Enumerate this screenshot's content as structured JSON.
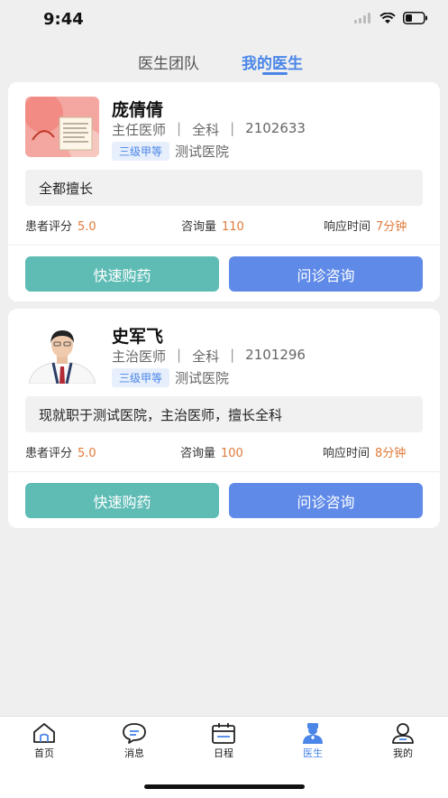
{
  "status": {
    "time": "9:44"
  },
  "tabs": [
    {
      "label": "医生团队",
      "active": false
    },
    {
      "label": "我的医生",
      "active": true
    }
  ],
  "doctors": [
    {
      "name": "庞倩倩",
      "title": "主任医师",
      "dept": "全科",
      "id": "2102633",
      "level": "三级甲等",
      "hospital": "测试医院",
      "specialty": "全都擅长",
      "stats": {
        "rating_label": "患者评分",
        "rating": "5.0",
        "consult_label": "咨询量",
        "consult": "110",
        "response_label": "响应时间",
        "response": "7分钟"
      },
      "buy_label": "快速购药",
      "consult_button_label": "问诊咨询"
    },
    {
      "name": "史军飞",
      "title": "主治医师",
      "dept": "全科",
      "id": "2101296",
      "level": "三级甲等",
      "hospital": "测试医院",
      "specialty": "现就职于测试医院，主治医师，擅长全科",
      "stats": {
        "rating_label": "患者评分",
        "rating": "5.0",
        "consult_label": "咨询量",
        "consult": "100",
        "response_label": "响应时间",
        "response": "8分钟"
      },
      "buy_label": "快速购药",
      "consult_button_label": "问诊咨询"
    }
  ],
  "nav": [
    {
      "label": "首页",
      "icon": "home-icon",
      "active": false
    },
    {
      "label": "消息",
      "icon": "message-icon",
      "active": false
    },
    {
      "label": "日程",
      "icon": "calendar-icon",
      "active": false
    },
    {
      "label": "医生",
      "icon": "doctor-icon",
      "active": true
    },
    {
      "label": "我的",
      "icon": "user-icon",
      "active": false
    }
  ],
  "colors": {
    "accent": "#4a86e8",
    "green_button": "#5fbcb5",
    "blue_button": "#5f8ae8",
    "stat_value": "#e07a3a",
    "badge_bg": "#e7effc"
  }
}
